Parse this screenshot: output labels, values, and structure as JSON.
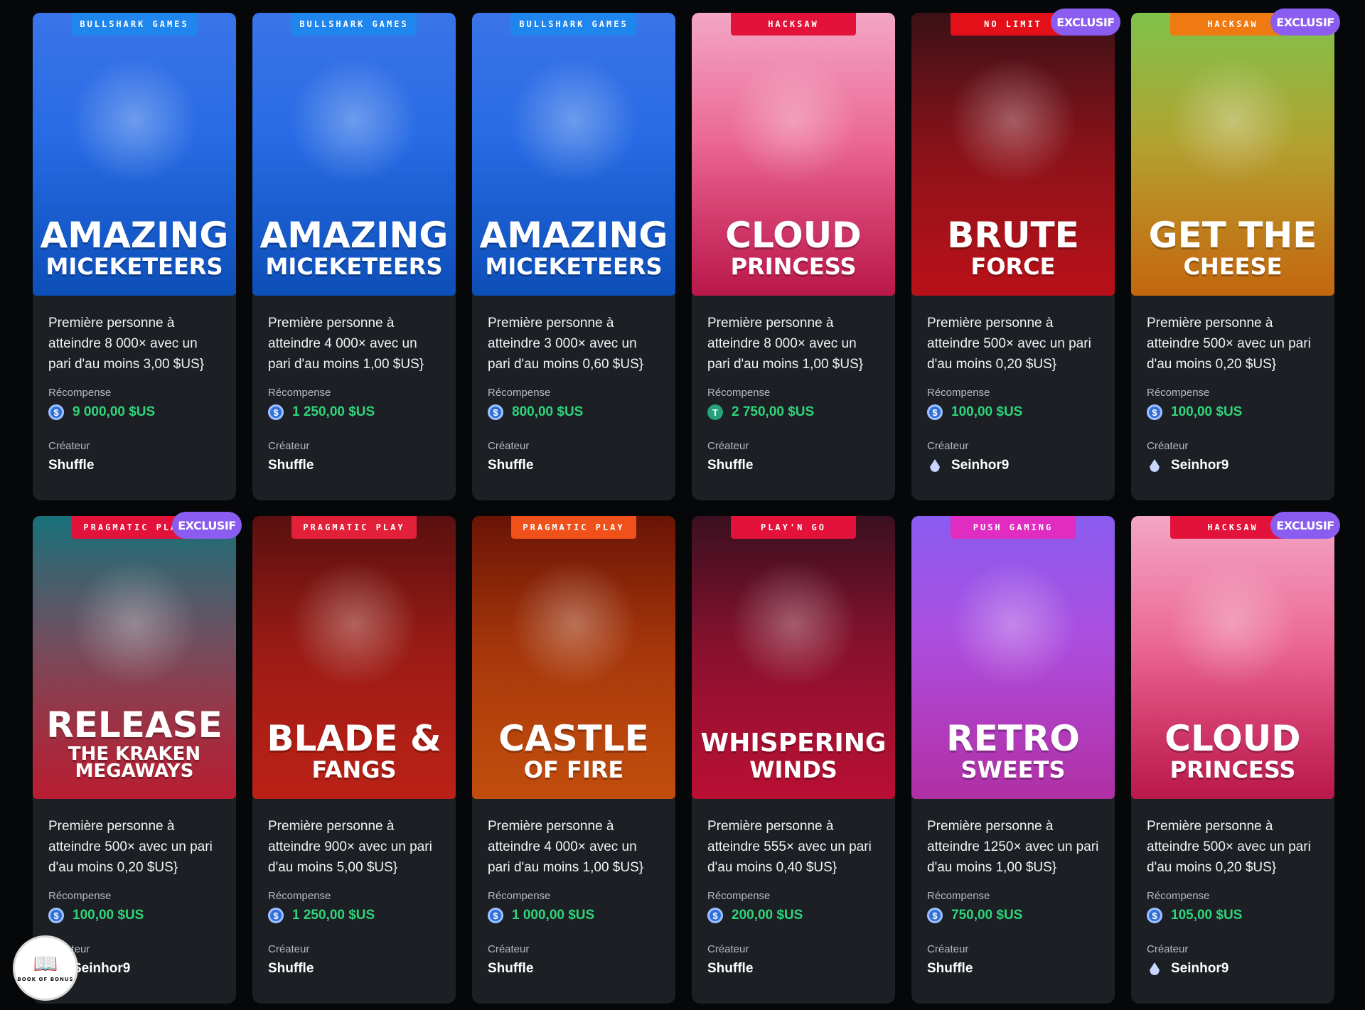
{
  "labels": {
    "reward": "Récompense",
    "creator": "Créateur",
    "exclusive": "EXCLUSIF"
  },
  "cards": [
    {
      "provider": "BULLSHARK GAMES",
      "provider_color": "#1f86ee",
      "exclusive": false,
      "title_line1": "AMAZING",
      "title_line2": "MICEKETEERS",
      "bg_top": "#3a74e8",
      "bg_bottom": "#1060e0",
      "challenge": "Première personne à atteindre 8 000× avec un pari d'au moins 3,00 $US}",
      "reward": "9 000,00 $US",
      "coin": "blue",
      "creator": "Shuffle",
      "creator_icon": false
    },
    {
      "provider": "BULLSHARK GAMES",
      "provider_color": "#1f86ee",
      "exclusive": false,
      "title_line1": "AMAZING",
      "title_line2": "MICEKETEERS",
      "bg_top": "#3a74e8",
      "bg_bottom": "#1060e0",
      "challenge": "Première personne à atteindre 4 000× avec un pari d'au moins 1,00 $US}",
      "reward": "1 250,00 $US",
      "coin": "blue",
      "creator": "Shuffle",
      "creator_icon": false
    },
    {
      "provider": "BULLSHARK GAMES",
      "provider_color": "#1f86ee",
      "exclusive": false,
      "title_line1": "AMAZING",
      "title_line2": "MICEKETEERS",
      "bg_top": "#3a74e8",
      "bg_bottom": "#1060e0",
      "challenge": "Première personne à atteindre 3 000× avec un pari d'au moins 0,60 $US}",
      "reward": "800,00 $US",
      "coin": "blue",
      "creator": "Shuffle",
      "creator_icon": false
    },
    {
      "provider": "HACKSAW",
      "provider_color": "#e3123a",
      "exclusive": false,
      "title_line1": "CLOUD",
      "title_line2": "PRINCESS",
      "bg_top": "#f3a6c4",
      "bg_bottom": "#e21d5b",
      "challenge": "Première personne à atteindre 8 000× avec un pari d'au moins 1,00 $US}",
      "reward": "2 750,00 $US",
      "coin": "green",
      "creator": "Shuffle",
      "creator_icon": false
    },
    {
      "provider": "NO LIMIT",
      "provider_color": "#e3101a",
      "exclusive": true,
      "title_line1": "BRUTE",
      "title_line2": "FORCE",
      "bg_top": "#3a1116",
      "bg_bottom": "#e0141e",
      "challenge": "Première personne à atteindre 500× avec un pari d'au moins 0,20 $US}",
      "reward": "100,00 $US",
      "coin": "blue",
      "creator": "Seinhor9",
      "creator_icon": true
    },
    {
      "provider": "HACKSAW",
      "provider_color": "#f07a12",
      "exclusive": true,
      "title_line1": "GET THE",
      "title_line2": "CHEESE",
      "bg_top": "#7fc24a",
      "bg_bottom": "#ee7d12",
      "challenge": "Première personne à atteindre 500× avec un pari d'au moins 0,20 $US}",
      "reward": "100,00 $US",
      "coin": "blue",
      "creator": "Seinhor9",
      "creator_icon": true
    },
    {
      "provider": "PRAGMATIC PLAY",
      "provider_color": "#e3123a",
      "exclusive": true,
      "title_line1": "RELEASE",
      "title_line2": "THE KRAKEN MEGAWAYS",
      "bg_top": "#18707a",
      "bg_bottom": "#e0233b",
      "challenge": "Première personne à atteindre 500× avec un pari d'au moins 0,20 $US}",
      "reward": "100,00 $US",
      "coin": "blue",
      "creator": "Seinhor9",
      "creator_icon": true
    },
    {
      "provider": "PRAGMATIC PLAY",
      "provider_color": "#e3203a",
      "exclusive": false,
      "title_line1": "BLADE &",
      "title_line2": "FANGS",
      "bg_top": "#5a1010",
      "bg_bottom": "#e2281a",
      "challenge": "Première personne à atteindre 900× avec un pari d'au moins 5,00 $US}",
      "reward": "1 250,00 $US",
      "coin": "blue",
      "creator": "Shuffle",
      "creator_icon": false
    },
    {
      "provider": "PRAGMATIC PLAY",
      "provider_color": "#f0501a",
      "exclusive": false,
      "title_line1": "CASTLE",
      "title_line2": "OF FIRE",
      "bg_top": "#6a1406",
      "bg_bottom": "#ea5d10",
      "challenge": "Première personne à atteindre 4 000× avec un pari d'au moins 1,00 $US}",
      "reward": "1 000,00 $US",
      "coin": "blue",
      "creator": "Shuffle",
      "creator_icon": false
    },
    {
      "provider": "PLAY'N GO",
      "provider_color": "#e3123a",
      "exclusive": false,
      "title_line1": "WHISPERING",
      "title_line2": "WINDS",
      "bg_top": "#3a1020",
      "bg_bottom": "#e0123e",
      "challenge": "Première personne à atteindre 555× avec un pari d'au moins 0,40 $US}",
      "reward": "200,00 $US",
      "coin": "blue",
      "creator": "Shuffle",
      "creator_icon": false
    },
    {
      "provider": "PUSH GAMING",
      "provider_color": "#e02cc0",
      "exclusive": false,
      "title_line1": "RETRO",
      "title_line2": "SWEETS",
      "bg_top": "#8a5cf0",
      "bg_bottom": "#d63ac8",
      "challenge": "Première personne à atteindre 1250× avec un pari d'au moins 1,00 $US}",
      "reward": "750,00 $US",
      "coin": "blue",
      "creator": "Shuffle",
      "creator_icon": false
    },
    {
      "provider": "HACKSAW",
      "provider_color": "#e3123a",
      "exclusive": true,
      "title_line1": "CLOUD",
      "title_line2": "PRINCESS",
      "bg_top": "#f3a6c4",
      "bg_bottom": "#e21d5b",
      "challenge": "Première personne à atteindre 500× avec un pari d'au moins 0,20 $US}",
      "reward": "105,00 $US",
      "coin": "blue",
      "creator": "Seinhor9",
      "creator_icon": true
    }
  ],
  "corner_logo": {
    "text": "BOOK OF BONUS",
    "icon": "open-book-icon"
  },
  "colors": {
    "page_bg": "#060708",
    "card_bg": "#1c1f24",
    "amount": "#2fd57a",
    "exclusive_bg": "#8a5cf0"
  }
}
